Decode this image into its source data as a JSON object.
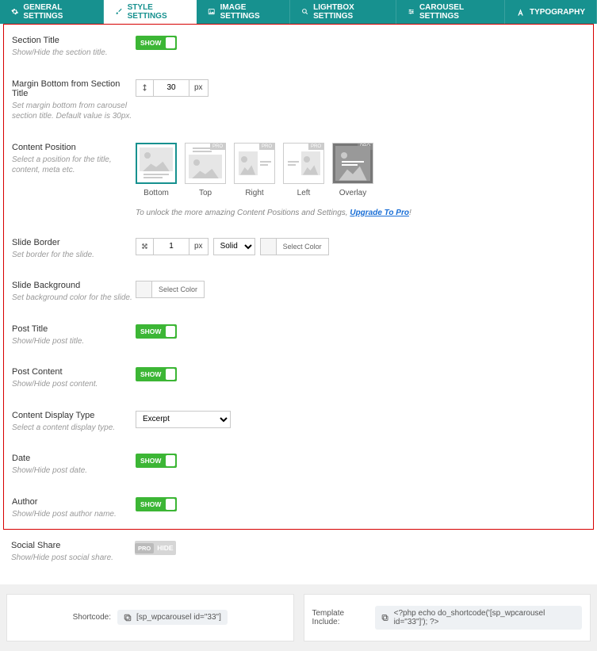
{
  "tabs": {
    "general": "GENERAL SETTINGS",
    "style": "STYLE SETTINGS",
    "image": "IMAGE SETTINGS",
    "lightbox": "LIGHTBOX SETTINGS",
    "carousel": "CAROUSEL SETTINGS",
    "typography": "TYPOGRAPHY"
  },
  "toggle": {
    "show": "SHOW",
    "hide": "HIDE",
    "pro": "PRO"
  },
  "sectionTitle": {
    "label": "Section Title",
    "desc": "Show/Hide the section title."
  },
  "marginBottom": {
    "label": "Margin Bottom from Section Title",
    "desc": "Set margin bottom from carousel section title. Default value is 30px.",
    "value": "30",
    "unit": "px"
  },
  "contentPosition": {
    "label": "Content Position",
    "desc": "Select a position for the title, content, meta etc.",
    "options": {
      "bottom": "Bottom",
      "top": "Top",
      "right": "Right",
      "left": "Left",
      "overlay": "Overlay"
    },
    "pro_badge": "PRO",
    "unlock_prefix": "To unlock the more amazing Content Positions and Settings, ",
    "unlock_link": "Upgrade To Pro",
    "unlock_suffix": "!"
  },
  "slideBorder": {
    "label": "Slide Border",
    "desc": "Set border for the slide.",
    "width": "1",
    "unit": "px",
    "style_options": [
      "Solid"
    ],
    "style_value": "Solid",
    "select_color": "Select Color"
  },
  "slideBackground": {
    "label": "Slide Background",
    "desc": "Set background color for the slide.",
    "select_color": "Select Color"
  },
  "postTitle": {
    "label": "Post Title",
    "desc": "Show/Hide post title."
  },
  "postContent": {
    "label": "Post Content",
    "desc": "Show/Hide post content."
  },
  "contentDisplayType": {
    "label": "Content Display Type",
    "desc": "Select a content display type.",
    "options": [
      "Excerpt"
    ],
    "value": "Excerpt"
  },
  "date": {
    "label": "Date",
    "desc": "Show/Hide post date."
  },
  "author": {
    "label": "Author",
    "desc": "Show/Hide post author name."
  },
  "socialShare": {
    "label": "Social Share",
    "desc": "Show/Hide post social share."
  },
  "footer": {
    "shortcode_label": "Shortcode:",
    "shortcode_code": "[sp_wpcarousel id=\"33\"]",
    "template_label": "Template Include:",
    "template_code": "<?php echo do_shortcode('[sp_wpcarousel id=\"33\"]'); ?>"
  }
}
